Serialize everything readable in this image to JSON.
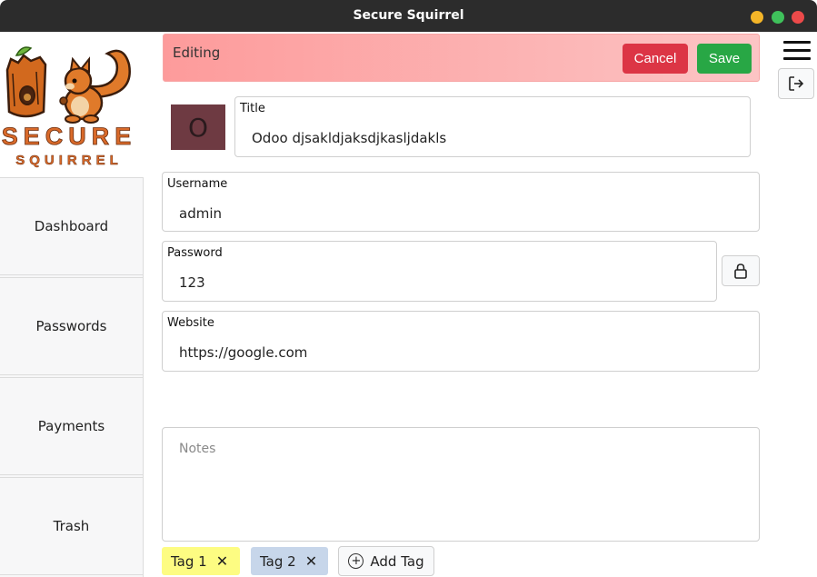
{
  "window": {
    "title": "Secure Squirrel"
  },
  "logo": {
    "line1": "SECURE",
    "line2": "SQUIRREL"
  },
  "sidebar": {
    "items": [
      {
        "label": "Dashboard"
      },
      {
        "label": "Passwords"
      },
      {
        "label": "Payments"
      },
      {
        "label": "Trash"
      }
    ]
  },
  "banner": {
    "label": "Editing",
    "cancel_label": "Cancel",
    "save_label": "Save"
  },
  "entry": {
    "avatar_letter": "O",
    "title_label": "Title",
    "title_value": "Odoo djsakldjaksdjkasljdakls",
    "username_label": "Username",
    "username_value": "admin",
    "password_label": "Password",
    "password_value": "123",
    "website_label": "Website",
    "website_value": "https://google.com",
    "notes_placeholder": "Notes"
  },
  "tags": [
    {
      "label": "Tag 1",
      "color": "#fdfc82"
    },
    {
      "label": "Tag 2",
      "color": "#c7d6ea"
    }
  ],
  "add_tag_label": "Add Tag",
  "colors": {
    "titlebar": "#2c2c2c",
    "cancel": "#dc3545",
    "save": "#28a745",
    "avatar": "#6e3a42",
    "banner_start": "#fd9b9b",
    "banner_end": "#fcc4c4"
  },
  "icons": {
    "lock": "lock-icon",
    "menu": "hamburger-menu-icon",
    "logout": "logout-icon",
    "add": "plus-circle-icon",
    "remove": "close-icon"
  }
}
